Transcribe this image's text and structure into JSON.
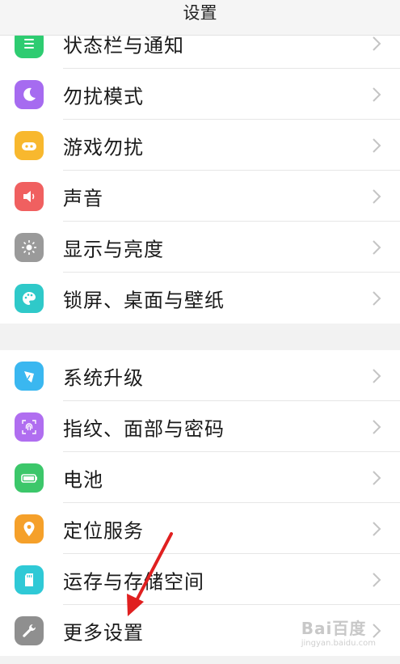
{
  "header": {
    "title": "设置"
  },
  "groups": [
    {
      "items": [
        {
          "label": "状态栏与通知",
          "icon": "notification-bar-icon",
          "color": "#2ecc71"
        },
        {
          "label": "勿扰模式",
          "icon": "moon-icon",
          "color": "#a66bf0"
        },
        {
          "label": "游戏勿扰",
          "icon": "gamepad-icon",
          "color": "#f8b82e"
        },
        {
          "label": "声音",
          "icon": "speaker-icon",
          "color": "#f06060"
        },
        {
          "label": "显示与亮度",
          "icon": "sun-icon",
          "color": "#9a9a9a"
        },
        {
          "label": "锁屏、桌面与壁纸",
          "icon": "palette-icon",
          "color": "#2fc9c9"
        }
      ]
    },
    {
      "items": [
        {
          "label": "系统升级",
          "icon": "system-update-icon",
          "color": "#3ab7f0"
        },
        {
          "label": "指纹、面部与密码",
          "icon": "fingerprint-icon",
          "color": "#b06ef0"
        },
        {
          "label": "电池",
          "icon": "battery-icon",
          "color": "#3cc76a"
        },
        {
          "label": "定位服务",
          "icon": "location-pin-icon",
          "color": "#f5a02a"
        },
        {
          "label": "运存与存储空间",
          "icon": "sd-card-icon",
          "color": "#2fc9d6"
        },
        {
          "label": "更多设置",
          "icon": "wrench-icon",
          "color": "#8f8f8f"
        }
      ]
    }
  ],
  "watermark": {
    "brand": "Bai百度",
    "sub": "jingyan.baidu.com"
  },
  "colors": {
    "annotation_arrow": "#e02020",
    "chevron": "#c4c4c4"
  }
}
